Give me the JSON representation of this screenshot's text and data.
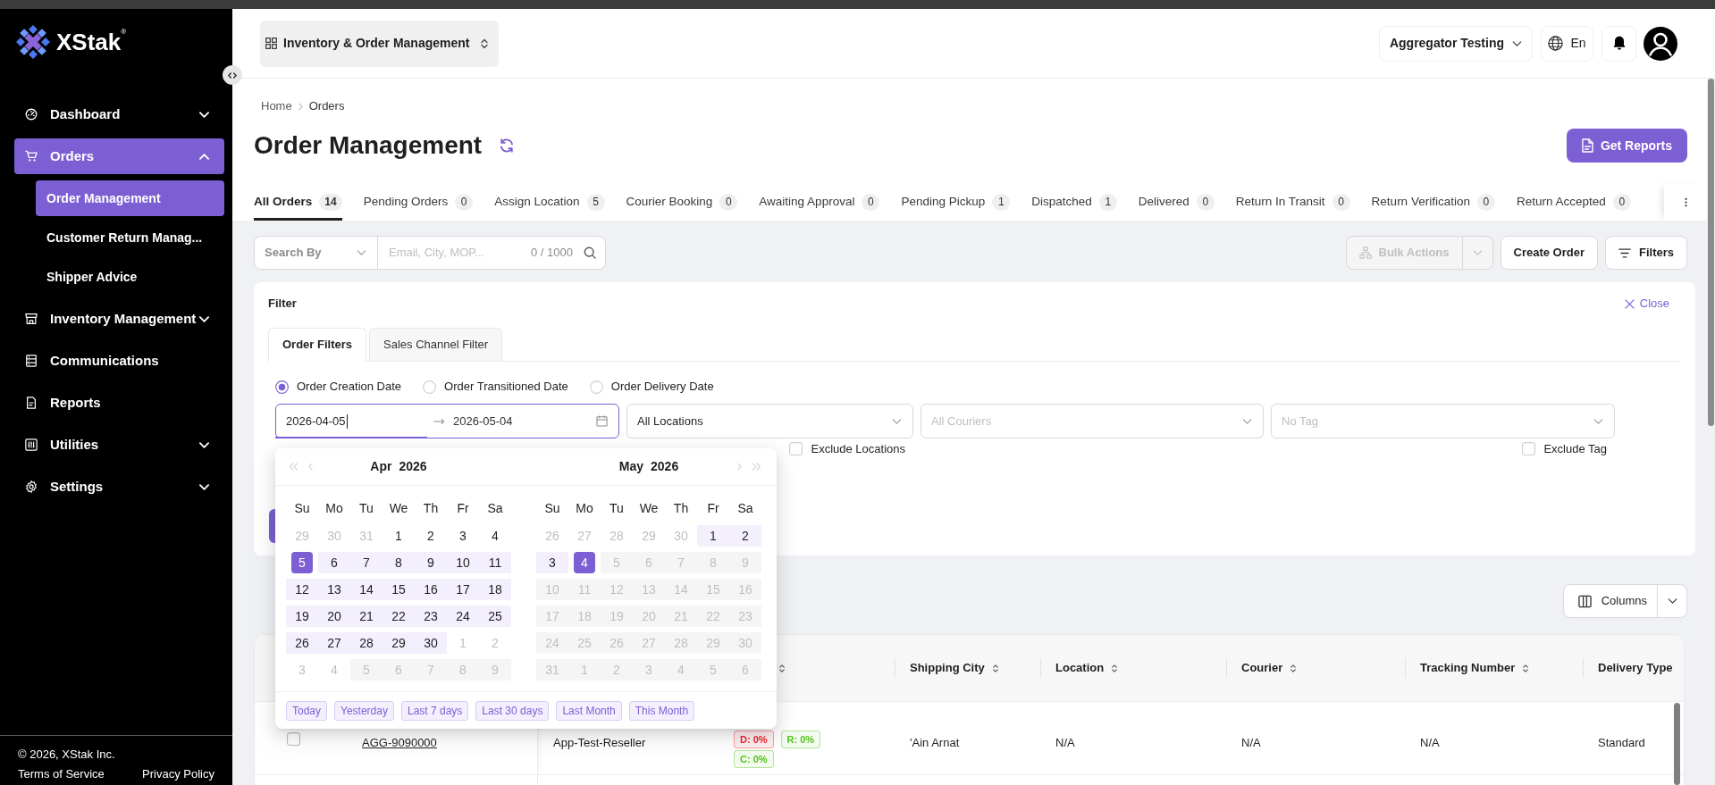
{
  "top_bar": {
    "app_switcher": "Inventory & Order Management",
    "account": "Aggregator Testing",
    "language": "En"
  },
  "sidebar": {
    "brand": "XStak$^{®}$",
    "items": [
      {
        "label": "Dashboard",
        "kind": "group",
        "expanded": false,
        "selected": false
      },
      {
        "label": "Orders",
        "kind": "group",
        "expanded": true,
        "selected": true,
        "children": [
          {
            "label": "Order Management",
            "selected": true
          },
          {
            "label": "Customer Return Manag...",
            "selected": false
          },
          {
            "label": "Shipper Advice",
            "selected": false
          }
        ]
      },
      {
        "label": "Inventory Management",
        "kind": "group",
        "expanded": false,
        "selected": false
      },
      {
        "label": "Communications",
        "kind": "link",
        "selected": false
      },
      {
        "label": "Reports",
        "kind": "link",
        "selected": false
      },
      {
        "label": "Utilities",
        "kind": "group",
        "expanded": false,
        "selected": false
      },
      {
        "label": "Settings",
        "kind": "group",
        "expanded": false,
        "selected": false
      }
    ],
    "footer": {
      "copyright": "© 2026, XStak Inc.",
      "links": [
        "Terms of Service",
        "Privacy Policy"
      ]
    }
  },
  "breadcrumb": [
    "Home",
    "Orders"
  ],
  "page": {
    "title": "Order Management",
    "report_button": "Get Reports"
  },
  "status_tabs": [
    {
      "label": "All Orders",
      "count": "14",
      "selected": true
    },
    {
      "label": "Pending Orders",
      "count": "0",
      "selected": false
    },
    {
      "label": "Assign Location",
      "count": "5",
      "selected": false
    },
    {
      "label": "Courier Booking",
      "count": "0",
      "selected": false
    },
    {
      "label": "Awaiting Approval",
      "count": "0",
      "selected": false
    },
    {
      "label": "Pending Pickup",
      "count": "1",
      "selected": false
    },
    {
      "label": "Dispatched",
      "count": "1",
      "selected": false
    },
    {
      "label": "Delivered",
      "count": "0",
      "selected": false
    },
    {
      "label": "Return In Transit",
      "count": "0",
      "selected": false
    },
    {
      "label": "Return Verification",
      "count": "0",
      "selected": false
    },
    {
      "label": "Return Accepted",
      "count": "0",
      "selected": false
    }
  ],
  "toolbar": {
    "search_by": {
      "placeholder": "Search By"
    },
    "search": {
      "placeholder": "Email, City, MOP...",
      "counter": "0 / 1000"
    },
    "bulk_actions": {
      "label": "Bulk Actions",
      "disabled": true
    },
    "create_order": "Create Order",
    "filters": "Filters"
  },
  "filter_panel": {
    "title": "Filter",
    "close": "Close",
    "tabs": [
      {
        "label": "Order Filters",
        "selected": true
      },
      {
        "label": "Sales Channel Filter",
        "selected": false
      }
    ],
    "date_types": [
      {
        "label": "Order Creation Date",
        "selected": true
      },
      {
        "label": "Order Transitioned Date",
        "selected": false
      },
      {
        "label": "Order Delivery Date",
        "selected": false
      }
    ],
    "date_range": {
      "start": {
        "value": "2026-04-05",
        "active": true
      },
      "end": {
        "value": "2026-05-04",
        "active": false
      }
    },
    "selects": [
      {
        "value": "All Locations",
        "exclude": {
          "label": "Exclude Locations",
          "checked": false
        }
      },
      {
        "placeholder": "All Couriers"
      },
      {
        "placeholder": "No Tag",
        "exclude": {
          "label": "Exclude Tag",
          "checked": false
        }
      }
    ],
    "calendar": {
      "months": [
        {
          "month": "Apr",
          "year": "2026",
          "weekdays": [
            "Su",
            "Mo",
            "Tu",
            "We",
            "Th",
            "Fr",
            "Sa"
          ],
          "weeks": [
            [
              {
                "day": "29",
                "kind": "outside"
              },
              {
                "day": "30",
                "kind": "outside"
              },
              {
                "day": "31",
                "kind": "outside"
              },
              {
                "day": "1",
                "kind": "day"
              },
              {
                "day": "2",
                "kind": "day"
              },
              {
                "day": "3",
                "kind": "day"
              },
              {
                "day": "4",
                "kind": "day"
              }
            ],
            [
              {
                "day": "5",
                "kind": "picked"
              },
              {
                "day": "6",
                "kind": "range"
              },
              {
                "day": "7",
                "kind": "range"
              },
              {
                "day": "8",
                "kind": "range"
              },
              {
                "day": "9",
                "kind": "range"
              },
              {
                "day": "10",
                "kind": "range"
              },
              {
                "day": "11",
                "kind": "range"
              }
            ],
            [
              {
                "day": "12",
                "kind": "range"
              },
              {
                "day": "13",
                "kind": "range"
              },
              {
                "day": "14",
                "kind": "range"
              },
              {
                "day": "15",
                "kind": "range"
              },
              {
                "day": "16",
                "kind": "range"
              },
              {
                "day": "17",
                "kind": "range"
              },
              {
                "day": "18",
                "kind": "range"
              }
            ],
            [
              {
                "day": "19",
                "kind": "range"
              },
              {
                "day": "20",
                "kind": "range"
              },
              {
                "day": "21",
                "kind": "range"
              },
              {
                "day": "22",
                "kind": "range"
              },
              {
                "day": "23",
                "kind": "range"
              },
              {
                "day": "24",
                "kind": "range"
              },
              {
                "day": "25",
                "kind": "range"
              }
            ],
            [
              {
                "day": "26",
                "kind": "range"
              },
              {
                "day": "27",
                "kind": "range"
              },
              {
                "day": "28",
                "kind": "range"
              },
              {
                "day": "29",
                "kind": "range"
              },
              {
                "day": "30",
                "kind": "range"
              },
              {
                "day": "1",
                "kind": "outside"
              },
              {
                "day": "2",
                "kind": "outside"
              }
            ],
            [
              {
                "day": "3",
                "kind": "outside"
              },
              {
                "day": "4",
                "kind": "outside"
              },
              {
                "day": "5",
                "kind": "disabled"
              },
              {
                "day": "6",
                "kind": "disabled"
              },
              {
                "day": "7",
                "kind": "disabled"
              },
              {
                "day": "8",
                "kind": "disabled"
              },
              {
                "day": "9",
                "kind": "disabled"
              }
            ]
          ]
        },
        {
          "month": "May",
          "year": "2026",
          "weekdays": [
            "Su",
            "Mo",
            "Tu",
            "We",
            "Th",
            "Fr",
            "Sa"
          ],
          "weeks": [
            [
              {
                "day": "26",
                "kind": "outside"
              },
              {
                "day": "27",
                "kind": "outside"
              },
              {
                "day": "28",
                "kind": "outside"
              },
              {
                "day": "29",
                "kind": "outside"
              },
              {
                "day": "30",
                "kind": "outside"
              },
              {
                "day": "1",
                "kind": "range"
              },
              {
                "day": "2",
                "kind": "range"
              }
            ],
            [
              {
                "day": "3",
                "kind": "range"
              },
              {
                "day": "4",
                "kind": "picked"
              },
              {
                "day": "5",
                "kind": "disabled"
              },
              {
                "day": "6",
                "kind": "disabled"
              },
              {
                "day": "7",
                "kind": "disabled"
              },
              {
                "day": "8",
                "kind": "disabled"
              },
              {
                "day": "9",
                "kind": "disabled"
              }
            ],
            [
              {
                "day": "10",
                "kind": "disabled"
              },
              {
                "day": "11",
                "kind": "disabled"
              },
              {
                "day": "12",
                "kind": "disabled"
              },
              {
                "day": "13",
                "kind": "disabled"
              },
              {
                "day": "14",
                "kind": "disabled"
              },
              {
                "day": "15",
                "kind": "disabled"
              },
              {
                "day": "16",
                "kind": "disabled"
              }
            ],
            [
              {
                "day": "17",
                "kind": "disabled"
              },
              {
                "day": "18",
                "kind": "disabled"
              },
              {
                "day": "19",
                "kind": "disabled"
              },
              {
                "day": "20",
                "kind": "disabled"
              },
              {
                "day": "21",
                "kind": "disabled"
              },
              {
                "day": "22",
                "kind": "disabled"
              },
              {
                "day": "23",
                "kind": "disabled"
              }
            ],
            [
              {
                "day": "24",
                "kind": "disabled"
              },
              {
                "day": "25",
                "kind": "disabled"
              },
              {
                "day": "26",
                "kind": "disabled"
              },
              {
                "day": "27",
                "kind": "disabled"
              },
              {
                "day": "28",
                "kind": "disabled"
              },
              {
                "day": "29",
                "kind": "disabled"
              },
              {
                "day": "30",
                "kind": "disabled"
              }
            ],
            [
              {
                "day": "31",
                "kind": "disabled"
              },
              {
                "day": "1",
                "kind": "disabled"
              },
              {
                "day": "2",
                "kind": "disabled"
              },
              {
                "day": "3",
                "kind": "disabled"
              },
              {
                "day": "4",
                "kind": "disabled"
              },
              {
                "day": "5",
                "kind": "disabled"
              },
              {
                "day": "6",
                "kind": "disabled"
              }
            ]
          ]
        }
      ],
      "presets": [
        "Today",
        "Yesterday",
        "Last 7 days",
        "Last 30 days",
        "Last Month",
        "This Month"
      ]
    }
  },
  "columns_button": "Columns",
  "table": {
    "columns": [
      {
        "kind": "covered",
        "sortable": true
      },
      {
        "kind": "label",
        "label": "Shipping City",
        "sortable": true
      },
      {
        "kind": "label",
        "label": "Location",
        "sortable": true
      },
      {
        "kind": "label",
        "label": "Courier",
        "sortable": true
      },
      {
        "kind": "label",
        "label": "Tracking Number",
        "sortable": true
      },
      {
        "kind": "label",
        "label": "Delivery Type",
        "sortable": false
      }
    ],
    "rows": [
      {
        "checked": false,
        "order_number": "AGG-9090000",
        "sales_channel": "App-Test-Reseller",
        "rates": [
          {
            "label": "D: 0%",
            "color": "#f5222d"
          },
          {
            "label": "R: 0%",
            "color": "#52c41a"
          },
          {
            "label": "C: 0%",
            "color": "#52c41a"
          }
        ],
        "shipping_city": "'Ain Arnat",
        "location": "N/A",
        "courier": "N/A",
        "tracking_number": "N/A",
        "delivery_type": "Standard"
      }
    ]
  }
}
